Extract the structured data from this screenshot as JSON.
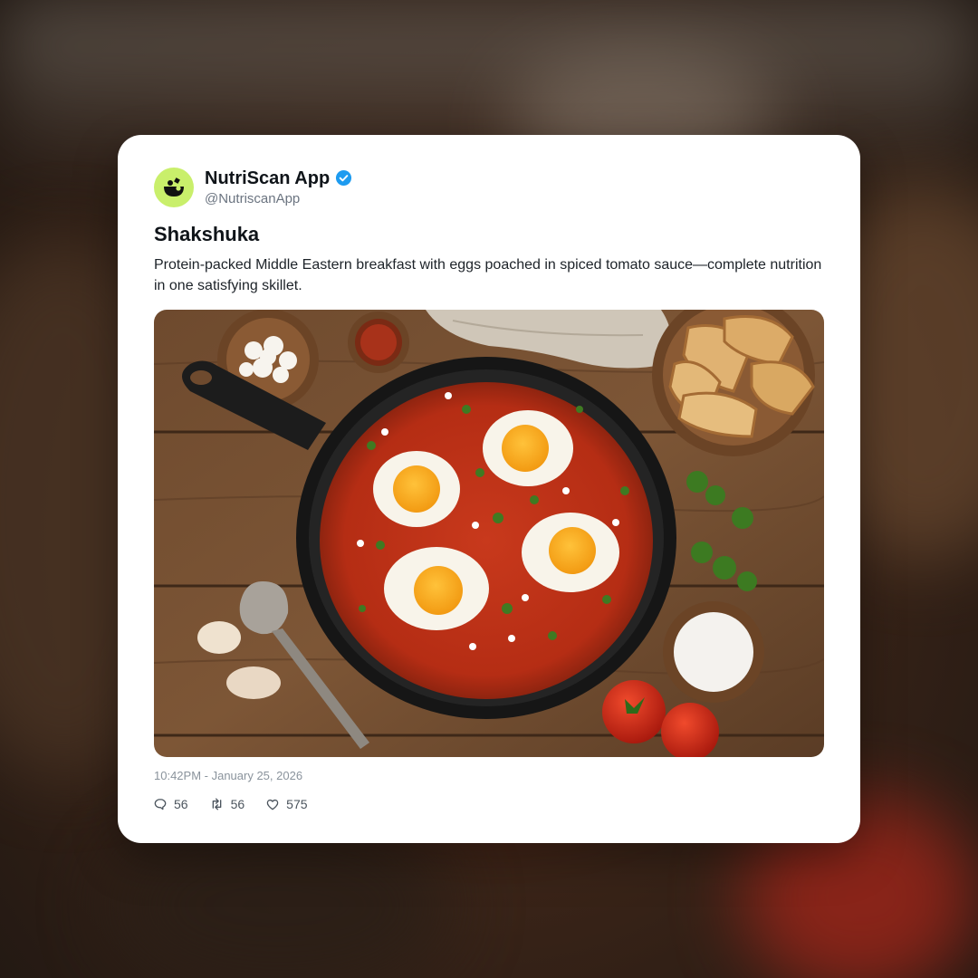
{
  "account": {
    "name": "NutriScan App",
    "handle": "@NutriscanApp",
    "verified": true,
    "avatar_color": "#c9ef6b",
    "verified_color": "#1d9bf0"
  },
  "post": {
    "title": "Shakshuka",
    "body": "Protein-packed Middle Eastern breakfast with eggs poached in spiced tomato sauce—complete nutrition in one satisfying skillet.",
    "image_icon": "food-photo-shakshuka-skillet",
    "timestamp": "10:42PM - January 25, 2026"
  },
  "stats": {
    "replies": "56",
    "reposts": "56",
    "likes": "575"
  },
  "icons": {
    "reply": "speech-bubble-icon",
    "repost": "repost-arrows-icon",
    "like": "heart-icon",
    "verified": "verified-check-icon",
    "logo": "nutriscan-logo-icon"
  }
}
